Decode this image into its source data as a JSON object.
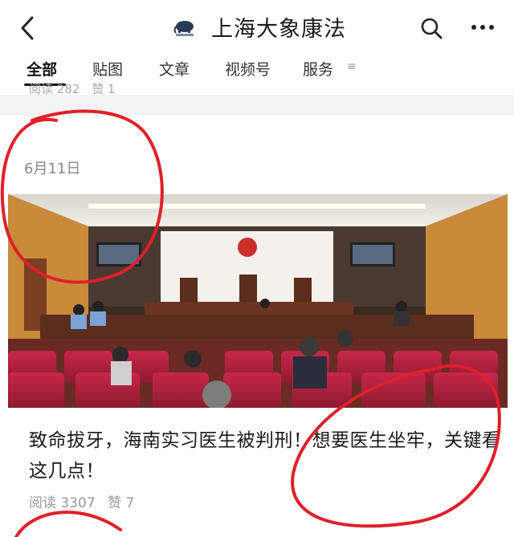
{
  "header": {
    "title": "上海大象康法",
    "logo_icon": "elephant-logo-icon",
    "back_icon": "back-arrow-icon",
    "search_icon": "search-icon",
    "more_icon": "more-dots-icon"
  },
  "tabs": [
    {
      "label": "全部",
      "active": true
    },
    {
      "label": "贴图",
      "active": false
    },
    {
      "label": "文章",
      "active": false
    },
    {
      "label": "视频号",
      "active": false
    },
    {
      "label": "服务",
      "active": false
    }
  ],
  "tab_menu_glyph": "≡",
  "previous_post": {
    "reads": "阅读 282",
    "likes": "赞 1"
  },
  "post": {
    "date": "6月11日",
    "title": "致命拔牙，海南实习医生被判刑！想要医生坐牢，关键看这几点！",
    "reads": "阅读 3307",
    "likes": "赞 7",
    "image_description": "courtroom-photo"
  },
  "colors": {
    "annotation_red": "#e0202a",
    "seat_red": "#b8203a",
    "wood": "#5a2d1c"
  }
}
